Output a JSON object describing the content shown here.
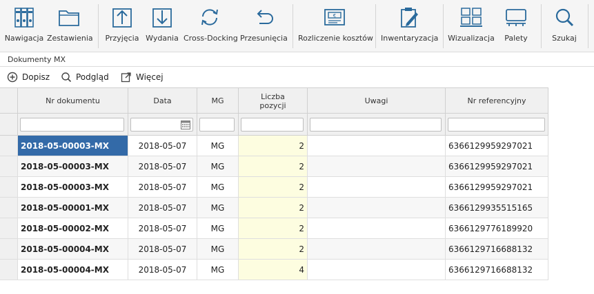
{
  "ribbon": {
    "items": [
      {
        "label": "Nawigacja",
        "icon": "binders-icon"
      },
      {
        "label": "Zestawienia",
        "icon": "folder-icon"
      },
      {
        "label": "Przyjęcia",
        "icon": "arrow-up-box-icon"
      },
      {
        "label": "Wydania",
        "icon": "arrow-down-box-icon"
      },
      {
        "label": "Cross-Docking",
        "icon": "refresh-icon"
      },
      {
        "label": "Przesunięcia",
        "icon": "undo-arrow-icon"
      },
      {
        "label": "Rozliczenie kosztów",
        "icon": "invoice-icon"
      },
      {
        "label": "Inwentaryzacja",
        "icon": "clipboard-pen-icon"
      },
      {
        "label": "Wizualizacja",
        "icon": "boxes-icon"
      },
      {
        "label": "Palety",
        "icon": "pallet-icon"
      },
      {
        "label": "Szukaj",
        "icon": "search-icon"
      }
    ]
  },
  "section": {
    "title": "Dokumenty MX"
  },
  "toolbar": {
    "add_label": "Dopisz",
    "preview_label": "Podgląd",
    "more_label": "Więcej"
  },
  "grid": {
    "columns": [
      "Nr dokumentu",
      "Data",
      "MG",
      "Liczba pozycji",
      "Uwagi",
      "Nr referencyjny"
    ],
    "rows": [
      {
        "nr": "2018-05-00003-MX",
        "data": "2018-05-07",
        "mg": "MG",
        "liczba": "2",
        "uwagi": "",
        "ref": "6366129959297021"
      },
      {
        "nr": "2018-05-00003-MX",
        "data": "2018-05-07",
        "mg": "MG",
        "liczba": "2",
        "uwagi": "",
        "ref": "6366129959297021"
      },
      {
        "nr": "2018-05-00003-MX",
        "data": "2018-05-07",
        "mg": "MG",
        "liczba": "2",
        "uwagi": "",
        "ref": "6366129959297021"
      },
      {
        "nr": "2018-05-00001-MX",
        "data": "2018-05-07",
        "mg": "MG",
        "liczba": "2",
        "uwagi": "",
        "ref": "6366129935515165"
      },
      {
        "nr": "2018-05-00002-MX",
        "data": "2018-05-07",
        "mg": "MG",
        "liczba": "2",
        "uwagi": "",
        "ref": "6366129776189920"
      },
      {
        "nr": "2018-05-00004-MX",
        "data": "2018-05-07",
        "mg": "MG",
        "liczba": "2",
        "uwagi": "",
        "ref": "6366129716688132"
      },
      {
        "nr": "2018-05-00004-MX",
        "data": "2018-05-07",
        "mg": "MG",
        "liczba": "4",
        "uwagi": "",
        "ref": "6366129716688132"
      }
    ]
  },
  "colors": {
    "accent": "#2a6a9c",
    "selection": "#336aa8",
    "count_bg": "#fdfde0"
  }
}
